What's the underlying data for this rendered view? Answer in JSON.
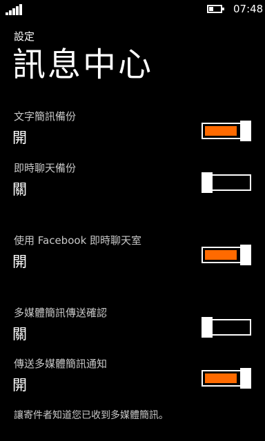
{
  "status_bar": {
    "time": "07:48",
    "signal_icon": "signal-strength-icon",
    "battery_icon": "battery-icon",
    "battery_level": 0.4
  },
  "header": {
    "app_title": "設定",
    "page_title": "訊息中心"
  },
  "accent_color": "#ff6a00",
  "settings": [
    {
      "label": "文字簡訊備份",
      "state": "開",
      "on": true
    },
    {
      "label": "即時聊天備份",
      "state": "關",
      "on": false
    },
    {
      "label": "使用 Facebook 即時聊天室",
      "state": "開",
      "on": true
    },
    {
      "label": "多媒體簡訊傳送確認",
      "state": "關",
      "on": false
    },
    {
      "label": "傳送多媒體簡訊通知",
      "state": "開",
      "on": true
    }
  ],
  "footnote": "讓寄件者知道您已收到多媒體簡訊。"
}
